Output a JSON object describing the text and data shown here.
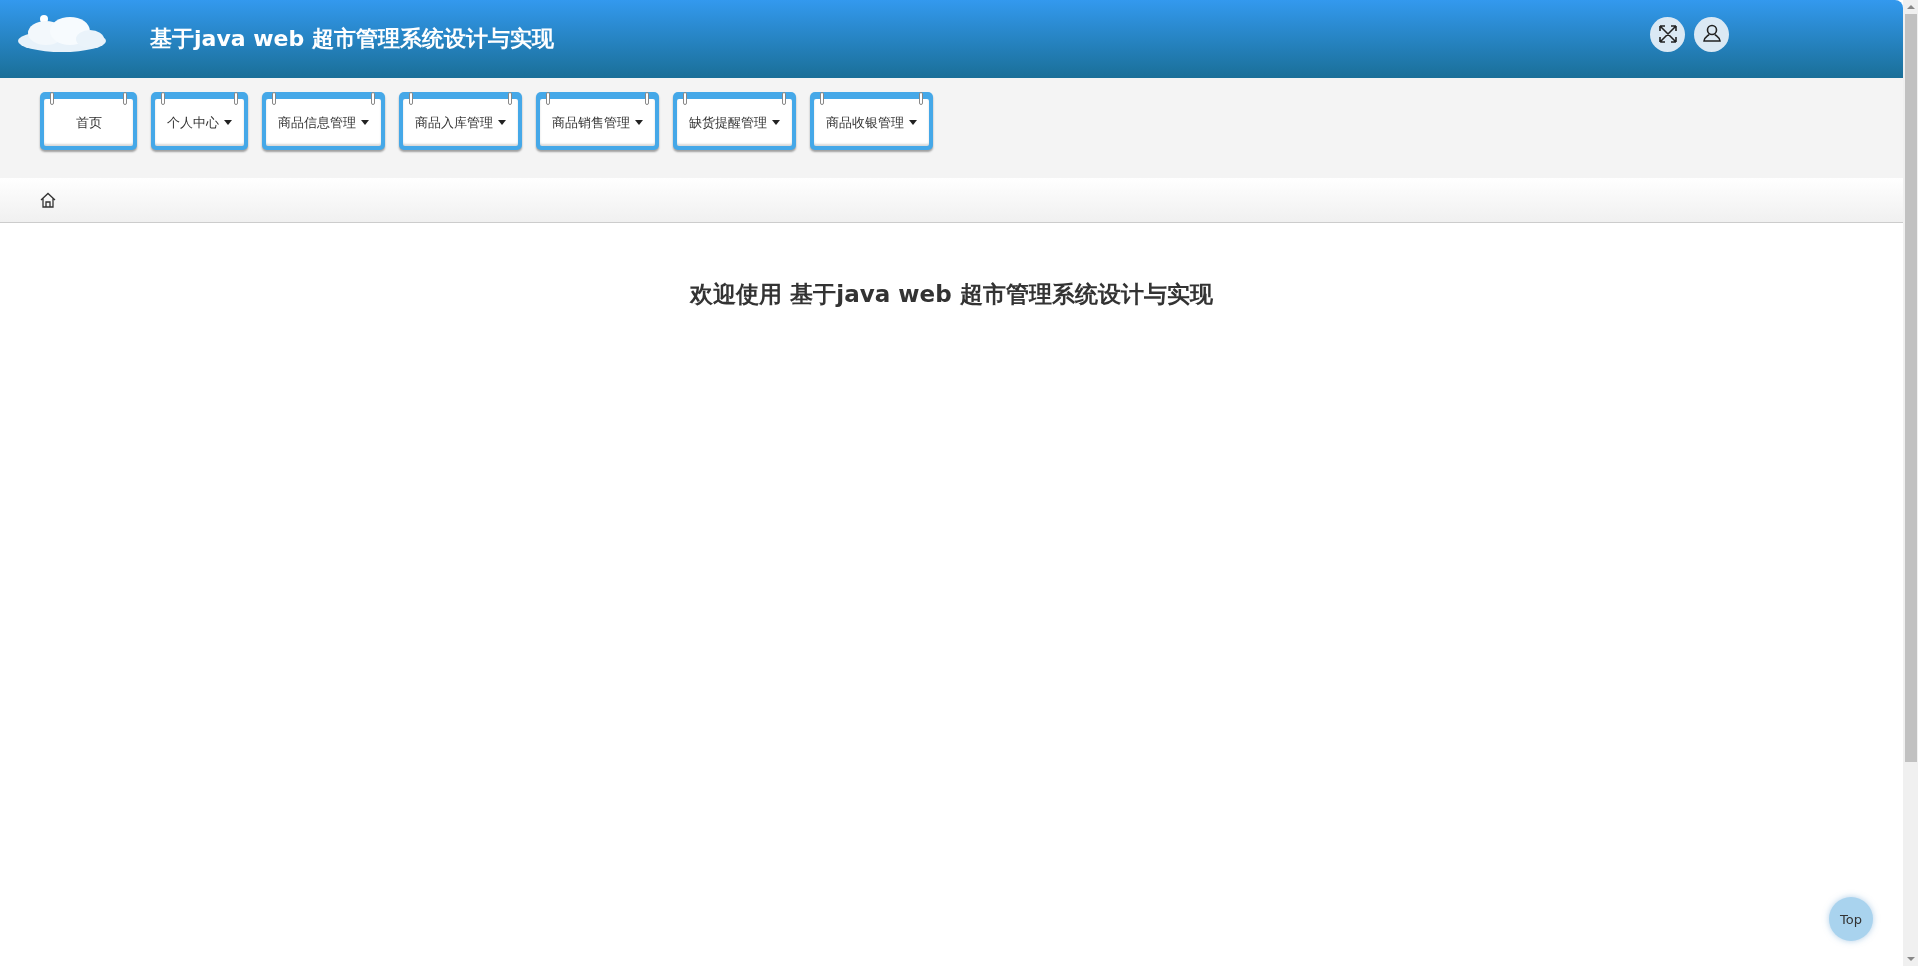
{
  "header": {
    "title": "基于java web 超市管理系统设计与实现"
  },
  "nav": {
    "items": [
      {
        "label": "首页",
        "dropdown": false
      },
      {
        "label": "个人中心",
        "dropdown": true
      },
      {
        "label": "商品信息管理",
        "dropdown": true
      },
      {
        "label": "商品入库管理",
        "dropdown": true
      },
      {
        "label": "商品销售管理",
        "dropdown": true
      },
      {
        "label": "缺货提醒管理",
        "dropdown": true
      },
      {
        "label": "商品收银管理",
        "dropdown": true
      }
    ]
  },
  "main": {
    "welcome": "欢迎使用 基于java web 超市管理系统设计与实现"
  },
  "back_to_top": {
    "label": "Top"
  }
}
